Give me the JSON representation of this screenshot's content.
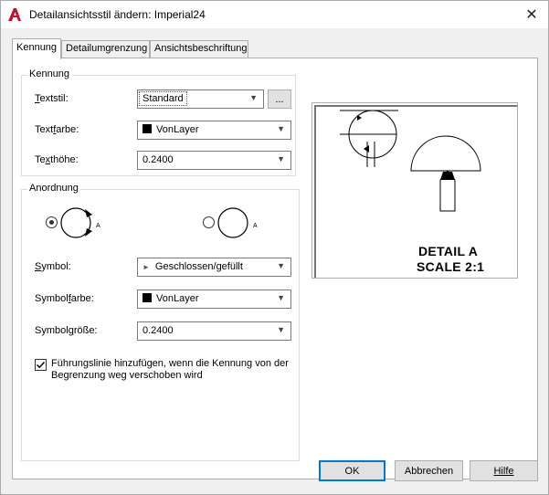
{
  "window": {
    "title": "Detailansichtsstil ändern: Imperial24",
    "close_glyph": "✕",
    "icon": "autocad-logo-icon"
  },
  "tabs": [
    {
      "label": "Kennung",
      "active": true
    },
    {
      "label": "Detailumgrenzung",
      "active": false
    },
    {
      "label": "Ansichtsbeschriftung",
      "active": false
    }
  ],
  "kennung": {
    "group_label": "Kennung",
    "textstil_label": "Textstil:",
    "textstil_value": "Standard",
    "browse_label": "...",
    "textfarbe_label": "Textfarbe:",
    "textfarbe_value": "VonLayer",
    "texthoehe_label": "Texthöhe:",
    "texthoehe_value": "0.2400"
  },
  "anordnung": {
    "group_label": "Anordnung",
    "option_inside_selected": true,
    "option_letter": "A",
    "symbol_label": "Symbol:",
    "symbol_value": "Geschlossen/gefüllt",
    "symbolfarbe_label": "Symbolfarbe:",
    "symbolfarbe_value": "VonLayer",
    "symbolgroesse_label": "Symbolgröße:",
    "symbolgroesse_value": "0.2400",
    "leader_checked": true,
    "leader_label": "Führungslinie hinzufügen, wenn die Kennung von der Begrenzung weg verschoben wird"
  },
  "preview": {
    "detail_line": "DETAIL A",
    "scale_line": "SCALE 2:1"
  },
  "buttons": {
    "ok": "OK",
    "cancel": "Abbrechen",
    "help": "Hilfe"
  },
  "colors": {
    "accent": "#0078d7",
    "logo_red": "#c8102e"
  }
}
